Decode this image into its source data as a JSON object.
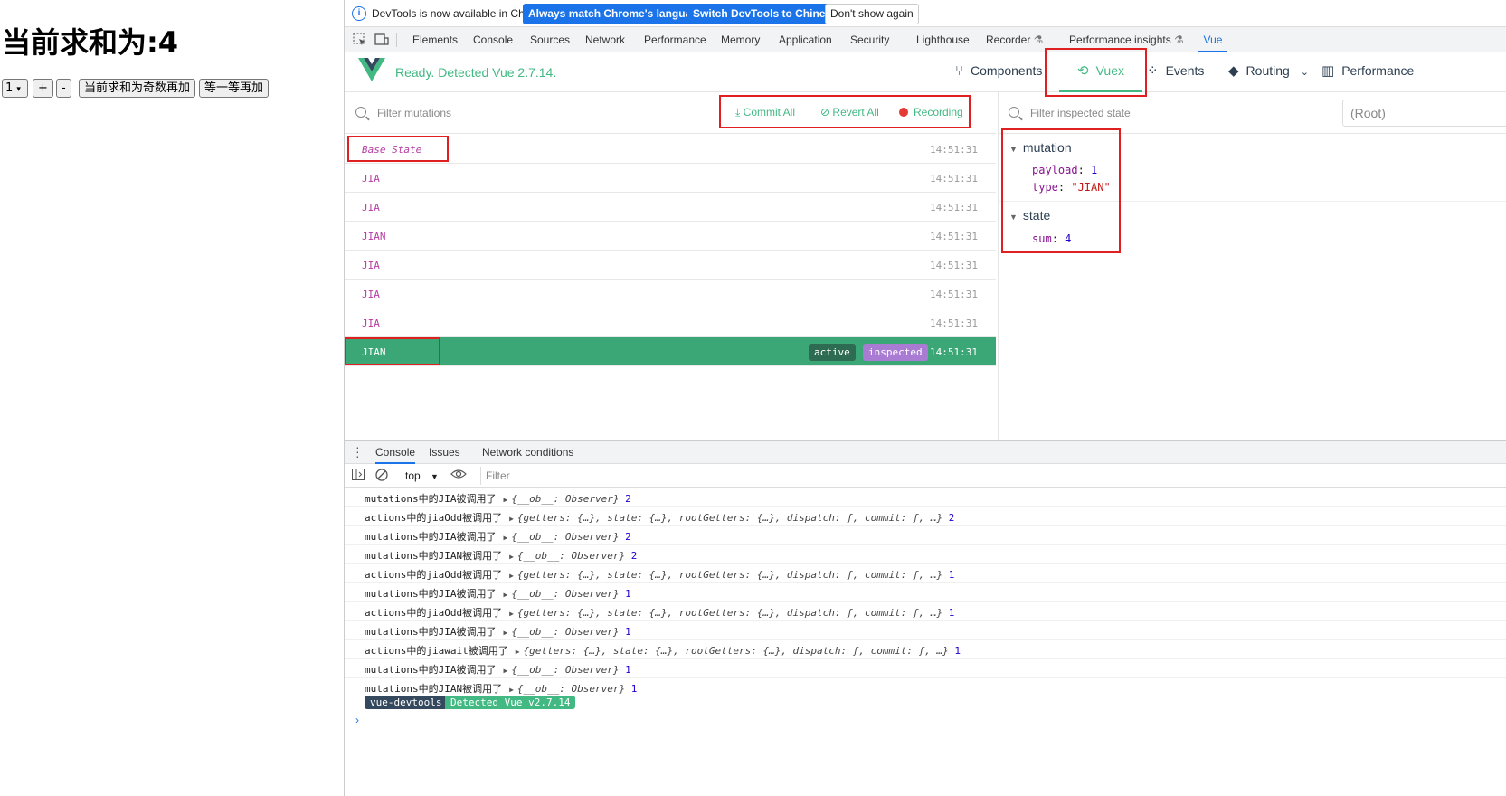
{
  "app": {
    "heading": "当前求和为:4",
    "select_value": "1",
    "plus_label": "+",
    "minus_label": "-",
    "odd_add_label": "当前求和为奇数再加",
    "wait_add_label": "等一等再加"
  },
  "infobar": {
    "text": "DevTools is now available in Chinese!",
    "btn_match": "Always match Chrome's language",
    "btn_switch": "Switch DevTools to Chinese",
    "btn_dismiss": "Don't show again"
  },
  "devtools_tabs": [
    "Elements",
    "Console",
    "Sources",
    "Network",
    "Performance",
    "Memory",
    "Application",
    "Security",
    "Lighthouse",
    "Recorder",
    "Performance insights",
    "Vue"
  ],
  "vue": {
    "status": "Ready. Detected Vue 2.7.14.",
    "nav": {
      "components": "Components",
      "vuex": "Vuex",
      "events": "Events",
      "routing": "Routing",
      "performance": "Performance"
    }
  },
  "mutations_panel": {
    "filter_placeholder": "Filter mutations",
    "commit_all": "Commit All",
    "revert_all": "Revert All",
    "recording": "Recording",
    "rows": [
      {
        "name": "Base State",
        "time": "14:51:31"
      },
      {
        "name": "JIA",
        "time": "14:51:31"
      },
      {
        "name": "JIA",
        "time": "14:51:31"
      },
      {
        "name": "JIAN",
        "time": "14:51:31"
      },
      {
        "name": "JIA",
        "time": "14:51:31"
      },
      {
        "name": "JIA",
        "time": "14:51:31"
      },
      {
        "name": "JIA",
        "time": "14:51:31"
      },
      {
        "name": "JIAN",
        "time": "14:51:31",
        "tag_active": "active",
        "tag_inspected": "inspected"
      }
    ]
  },
  "inspector": {
    "filter_placeholder": "Filter inspected state",
    "root_select": "(Root)",
    "mutation_title": "mutation",
    "payload_key": "payload",
    "payload_value": "1",
    "type_key": "type",
    "type_value": "\"JIAN\"",
    "state_title": "state",
    "sum_key": "sum",
    "sum_value": "4"
  },
  "drawer": {
    "tabs": [
      "Console",
      "Issues",
      "Network conditions"
    ],
    "context": "top",
    "filter_placeholder": "Filter",
    "logs": [
      {
        "msg": "mutations中的JIA被调用了",
        "obj": "{__ob__: Observer}",
        "num": "2"
      },
      {
        "msg": "actions中的jiaOdd被调用了",
        "obj": "{getters: {…}, state: {…}, rootGetters: {…}, dispatch: ƒ, commit: ƒ, …}",
        "num": "2"
      },
      {
        "msg": "mutations中的JIA被调用了",
        "obj": "{__ob__: Observer}",
        "num": "2"
      },
      {
        "msg": "mutations中的JIAN被调用了",
        "obj": "{__ob__: Observer}",
        "num": "2"
      },
      {
        "msg": "actions中的jiaOdd被调用了",
        "obj": "{getters: {…}, state: {…}, rootGetters: {…}, dispatch: ƒ, commit: ƒ, …}",
        "num": "1"
      },
      {
        "msg": "mutations中的JIA被调用了",
        "obj": "{__ob__: Observer}",
        "num": "1"
      },
      {
        "msg": "actions中的jiaOdd被调用了",
        "obj": "{getters: {…}, state: {…}, rootGetters: {…}, dispatch: ƒ, commit: ƒ, …}",
        "num": "1"
      },
      {
        "msg": "mutations中的JIA被调用了",
        "obj": "{__ob__: Observer}",
        "num": "1"
      },
      {
        "msg": "actions中的jiawait被调用了",
        "obj": "{getters: {…}, state: {…}, rootGetters: {…}, dispatch: ƒ, commit: ƒ, …}",
        "num": "1"
      },
      {
        "msg": "mutations中的JIA被调用了",
        "obj": "{__ob__: Observer}",
        "num": "1"
      },
      {
        "msg": "mutations中的JIAN被调用了",
        "obj": "{__ob__: Observer}",
        "num": "1"
      }
    ],
    "badge_left": "vue-devtools",
    "badge_right": "Detected Vue v2.7.14",
    "prompt": "›"
  },
  "colors": {
    "vue_green": "#42b883",
    "selected_row": "#3ba776",
    "highlight_red": "#e02020",
    "chrome_blue": "#1a73e8"
  }
}
